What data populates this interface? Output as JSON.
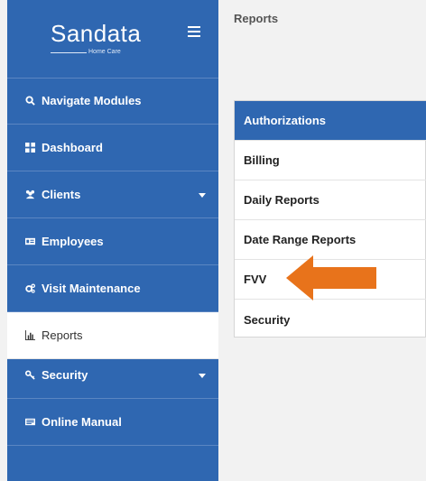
{
  "brand": {
    "name": "Sandata",
    "tagline": "Home Care"
  },
  "sidebar": {
    "items": [
      {
        "label": "Navigate Modules",
        "icon": "search-icon"
      },
      {
        "label": "Dashboard",
        "icon": "grid-icon"
      },
      {
        "label": "Clients",
        "icon": "users-icon",
        "has_dropdown": true
      },
      {
        "label": "Employees",
        "icon": "id-card-icon"
      },
      {
        "label": "Visit Maintenance",
        "icon": "gears-icon"
      },
      {
        "label": "Reports",
        "icon": "bar-chart-icon",
        "active": true
      },
      {
        "label": "Security",
        "icon": "key-icon",
        "has_dropdown": true
      },
      {
        "label": "Online Manual",
        "icon": "book-icon"
      }
    ]
  },
  "main": {
    "breadcrumb": "Reports",
    "report_menu": {
      "header": "Authorizations",
      "items": [
        "Billing",
        "Daily Reports",
        "Date Range Reports",
        "FVV",
        "Security"
      ],
      "highlighted": "FVV"
    }
  },
  "colors": {
    "sidebar_bg": "#2f67b1",
    "arrow": "#e8731b",
    "active_bg": "#ffffff"
  }
}
